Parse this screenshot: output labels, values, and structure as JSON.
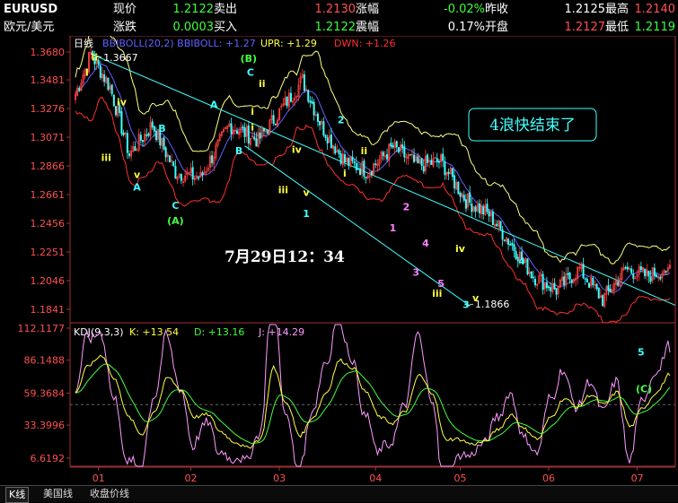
{
  "quote": {
    "symbol": "EURUSD",
    "name": "欧元/美元",
    "row1": [
      {
        "label": "现价",
        "value": "1.2122",
        "vcolor": "#3cff3c"
      },
      {
        "label": "卖出",
        "value": "1.2130",
        "vcolor": "#ff5050"
      },
      {
        "label": "涨幅",
        "value": "-0.02%",
        "vcolor": "#3cff3c"
      },
      {
        "label": "昨收",
        "value": "1.2125",
        "vcolor": "#ffffff"
      },
      {
        "label": "最高",
        "value": "1.2140",
        "vcolor": "#ff5050"
      }
    ],
    "row2": [
      {
        "label": "涨跌",
        "value": "0.0003",
        "vcolor": "#3cff3c"
      },
      {
        "label": "买入",
        "value": "1.2122",
        "vcolor": "#3cff3c"
      },
      {
        "label": "震幅",
        "value": "0.17%",
        "vcolor": "#ffffff"
      },
      {
        "label": "开盘",
        "value": "1.2127",
        "vcolor": "#ff5050"
      },
      {
        "label": "最低",
        "value": "1.2119",
        "vcolor": "#3cff3c"
      }
    ]
  },
  "chart_data": [
    {
      "type": "candlestick",
      "period_label": "日线",
      "indicator": "BBIBOLL(20,2) BBIBOLL: +1.27",
      "upr": "UPR: +1.29",
      "dwn": "DWN: +1.26",
      "ylim": [
        1.1841,
        1.368
      ],
      "y_ticks": [
        "1.3680",
        "1.3481",
        "1.3276",
        "1.3071",
        "1.2866",
        "1.2661",
        "1.2456",
        "1.2251",
        "1.2046",
        "1.1841"
      ],
      "high_label": "1.3667",
      "low_label": "1.1866",
      "key_closes": [
        {
          "i": 0,
          "v": 1.338
        },
        {
          "i": 8,
          "v": 1.3667
        },
        {
          "i": 18,
          "v": 1.343
        },
        {
          "i": 28,
          "v": 1.295
        },
        {
          "i": 40,
          "v": 1.316
        },
        {
          "i": 52,
          "v": 1.282
        },
        {
          "i": 65,
          "v": 1.278
        },
        {
          "i": 80,
          "v": 1.316
        },
        {
          "i": 95,
          "v": 1.305
        },
        {
          "i": 108,
          "v": 1.329
        },
        {
          "i": 118,
          "v": 1.348
        },
        {
          "i": 128,
          "v": 1.315
        },
        {
          "i": 140,
          "v": 1.29
        },
        {
          "i": 152,
          "v": 1.283
        },
        {
          "i": 165,
          "v": 1.3
        },
        {
          "i": 178,
          "v": 1.287
        },
        {
          "i": 190,
          "v": 1.29
        },
        {
          "i": 203,
          "v": 1.262
        },
        {
          "i": 215,
          "v": 1.252
        },
        {
          "i": 228,
          "v": 1.228
        },
        {
          "i": 238,
          "v": 1.208
        },
        {
          "i": 250,
          "v": 1.198
        },
        {
          "i": 262,
          "v": 1.213
        },
        {
          "i": 274,
          "v": 1.191
        },
        {
          "i": 286,
          "v": 1.213
        },
        {
          "i": 297,
          "v": 1.208
        },
        {
          "i": 306,
          "v": 1.212
        }
      ],
      "wave_labels": [
        {
          "text": "i",
          "i": 6,
          "v": 1.351,
          "color": "#ffff40"
        },
        {
          "text": "ii",
          "i": 10,
          "v": 1.362,
          "color": "#ffff40"
        },
        {
          "text": "iii",
          "i": 16,
          "v": 1.29,
          "color": "#ffff40"
        },
        {
          "text": "iv",
          "i": 24,
          "v": 1.33,
          "color": "#ffff40"
        },
        {
          "text": "v",
          "i": 32,
          "v": 1.278,
          "color": "#ffff40"
        },
        {
          "text": "A",
          "i": 32,
          "v": 1.269,
          "color": "#40ffff"
        },
        {
          "text": "B",
          "i": 45,
          "v": 1.311,
          "color": "#40ffff"
        },
        {
          "text": "C",
          "i": 52,
          "v": 1.256,
          "color": "#40ffff"
        },
        {
          "text": "(A)",
          "i": 52,
          "v": 1.245,
          "color": "#40ff40"
        },
        {
          "text": "A",
          "i": 72,
          "v": 1.328,
          "color": "#40ffff"
        },
        {
          "text": "B",
          "i": 85,
          "v": 1.295,
          "color": "#40ffff"
        },
        {
          "text": "i",
          "i": 92,
          "v": 1.323,
          "color": "#ffff40"
        },
        {
          "text": "(B)",
          "i": 90,
          "v": 1.361,
          "color": "#40ff40"
        },
        {
          "text": "C",
          "i": 91,
          "v": 1.351,
          "color": "#40ffff"
        },
        {
          "text": "ii",
          "i": 97,
          "v": 1.343,
          "color": "#ffff40"
        },
        {
          "text": "i",
          "i": 92,
          "v": 1.312,
          "color": "#ffff40"
        },
        {
          "text": "iv",
          "i": 115,
          "v": 1.296,
          "color": "#ffff40"
        },
        {
          "text": "iii",
          "i": 108,
          "v": 1.267,
          "color": "#ffff40"
        },
        {
          "text": "v",
          "i": 120,
          "v": 1.265,
          "color": "#ffff40"
        },
        {
          "text": "1",
          "i": 120,
          "v": 1.25,
          "color": "#40ffff"
        },
        {
          "text": "2",
          "i": 138,
          "v": 1.317,
          "color": "#40ffff"
        },
        {
          "text": "i",
          "i": 140,
          "v": 1.279,
          "color": "#ffff40"
        },
        {
          "text": "ii",
          "i": 150,
          "v": 1.295,
          "color": "#ffff40"
        },
        {
          "text": "1",
          "i": 165,
          "v": 1.24,
          "color": "#ff80ff"
        },
        {
          "text": "2",
          "i": 172,
          "v": 1.255,
          "color": "#ff80ff"
        },
        {
          "text": "3",
          "i": 177,
          "v": 1.208,
          "color": "#ff80ff"
        },
        {
          "text": "4",
          "i": 182,
          "v": 1.229,
          "color": "#ff80ff"
        },
        {
          "text": "iii",
          "i": 188,
          "v": 1.193,
          "color": "#ffff40"
        },
        {
          "text": "5",
          "i": 190,
          "v": 1.2,
          "color": "#ff80ff"
        },
        {
          "text": "3",
          "i": 203,
          "v": 1.185,
          "color": "#40ffff"
        },
        {
          "text": "iv",
          "i": 200,
          "v": 1.225,
          "color": "#ffff40"
        },
        {
          "text": "v",
          "i": 208,
          "v": 1.19,
          "color": "#ffff40"
        },
        {
          "text": "4",
          "i": 232,
          "v": 1.216,
          "color": "#40ffff"
        }
      ],
      "annotation_box": "4浪快结束了",
      "timestamp_label": "7月29日12：34"
    },
    {
      "type": "line",
      "indicator_label": "KDJ(9,3,3)",
      "k_label": "K: +13.54",
      "d_label": "D: +13.16",
      "j_label": "J: +14.29",
      "ylim": [
        0,
        115
      ],
      "y_ticks": [
        "112.1177",
        "86.1488",
        "59.3684",
        "33.3996",
        "6.6192"
      ],
      "series": [
        {
          "key": "K",
          "color": "#ffff40"
        },
        {
          "key": "D",
          "color": "#40ff40"
        },
        {
          "key": "J",
          "color": "#ff9bff"
        }
      ],
      "k_anchor_values": [
        60,
        82,
        90,
        70,
        40,
        26,
        45,
        72,
        62,
        40,
        42,
        28,
        20,
        15,
        22,
        80,
        50,
        25,
        40,
        60,
        86,
        80,
        60,
        40,
        35,
        45,
        74,
        60,
        22,
        22,
        18,
        20,
        30,
        42,
        30,
        22,
        40,
        55,
        48,
        58,
        50,
        60,
        32,
        48,
        60,
        75
      ],
      "labels_right": [
        {
          "text": "5",
          "color": "#40ffff"
        },
        {
          "text": "(C)",
          "color": "#40ff40"
        }
      ]
    }
  ],
  "x_axis": {
    "months": [
      "01",
      "02",
      "03",
      "04",
      "05",
      "06",
      "07"
    ]
  },
  "bottom_tabs": [
    {
      "label": "K线",
      "active": true
    },
    {
      "label": "美国线",
      "active": false
    },
    {
      "label": "收盘价线",
      "active": false
    }
  ]
}
